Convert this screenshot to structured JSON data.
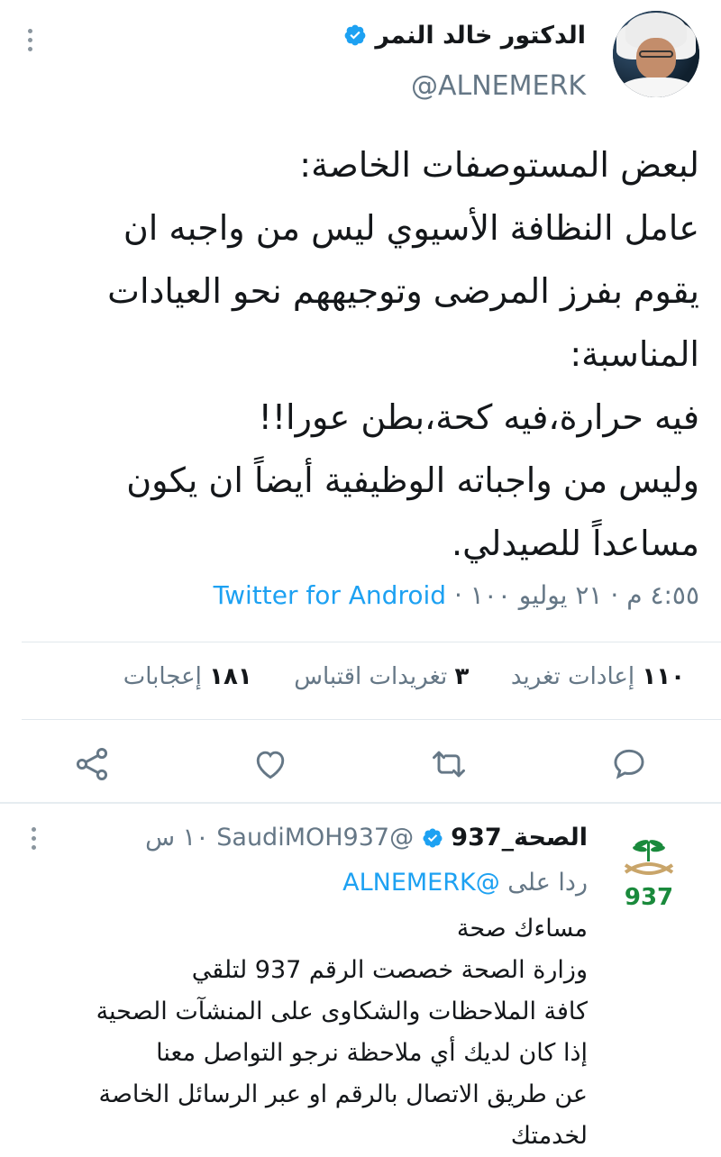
{
  "tweet": {
    "author_name": "الدكتور خالد النمر",
    "handle": "@ALNEMERK",
    "text_lines": [
      "لبعض المستوصفات الخاصة:",
      "عامل النظافة الأسيوي ليس من واجبه ان",
      "يقوم بفرز المرضى وتوجيههم نحو العيادات",
      "المناسبة:",
      "فيه حرارة،فيه كحة،بطن عورا!!",
      "وليس من واجباته الوظيفية أيضاً ان يكون",
      "مساعداً للصيدلي."
    ],
    "time": "٤:٥٥ م",
    "date": "٢١ يوليو ١٠٠",
    "separator": "·",
    "source": "Twitter for Android",
    "stats": {
      "retweets_count": "١١٠",
      "retweets_label": "إعادات تغريد",
      "quotes_count": "٣",
      "quotes_label": "تغريدات اقتباس",
      "likes_count": "١٨١",
      "likes_label": "إعجابات"
    },
    "icons": {
      "reply": "comment-icon",
      "retweet": "retweet-icon",
      "like": "heart-icon",
      "share": "share-icon"
    }
  },
  "reply": {
    "author_name": "الصحة_937",
    "handle": "@SaudiMOH937",
    "time": "١٠ س",
    "replying_to_label": "ردا على",
    "replying_to_handle": "@ALNEMERK",
    "avatar_text": "937",
    "text_lines": [
      "مساءك صحة",
      "وزارة الصحة خصصت الرقم 937 لتلقي",
      "كافة الملاحظات والشكاوى على المنشآت الصحية",
      "إذا كان لديك أي ملاحظة نرجو التواصل معنا",
      "عن طريق الاتصال بالرقم او عبر الرسائل الخاصة",
      "لخدمتك"
    ]
  },
  "colors": {
    "accent": "#1da1f2",
    "muted": "#657786",
    "text": "#14171a",
    "logo_green": "#1a8a3c"
  }
}
